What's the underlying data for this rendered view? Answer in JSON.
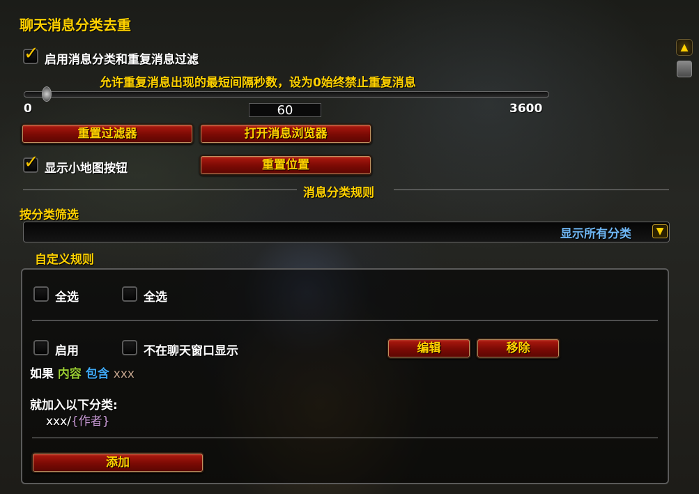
{
  "title": "聊天消息分类去重",
  "enable_filter": {
    "label": "启用消息分类和重复消息过滤",
    "checked": true
  },
  "slider": {
    "caption": "允许重复消息出现的最短间隔秒数，设为0始终禁止重复消息",
    "min": "0",
    "max": "3600",
    "value": "60"
  },
  "buttons": {
    "reset_filter": "重置过滤器",
    "open_browser": "打开消息浏览器",
    "reset_position": "重置位置",
    "edit": "编辑",
    "remove": "移除",
    "add": "添加"
  },
  "minimap": {
    "label": "显示小地图按钮",
    "checked": true
  },
  "section_rules": "消息分类规则",
  "filter_by": {
    "label": "按分类筛选",
    "value": "显示所有分类"
  },
  "custom_rules": "自定义规则",
  "select_all_1": "全选",
  "select_all_2": "全选",
  "rule": {
    "enable": "启用",
    "hide_chat": "不在聊天窗口显示",
    "if": "如果",
    "field": "内容",
    "op": "包含",
    "pattern": "xxx",
    "then": "就加入以下分类:",
    "category": "xxx",
    "sep": "/",
    "author": "{作者}"
  },
  "colors": {
    "gold": "#ffd100",
    "field": "#9acd32",
    "op": "#3fa9f5",
    "pattern": "#c8a890",
    "author": "#c99bd6",
    "dropdown_text": "#6fb7f5"
  },
  "icons": {
    "checkbox": "check-icon",
    "dropdown": "arrow-down-icon",
    "scroll": "scroll-up-icon"
  }
}
